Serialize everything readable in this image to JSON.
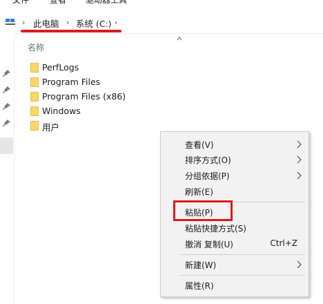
{
  "top_strip": {
    "items": [
      "文件",
      "查看",
      "驱动器工具"
    ]
  },
  "address_bar": {
    "crumbs": [
      "此电脑",
      "系统 (C:)"
    ]
  },
  "file_list": {
    "column_header": "名称",
    "items": [
      {
        "name": "PerfLogs",
        "icon": "folder-icon"
      },
      {
        "name": "Program Files",
        "icon": "folder-icon"
      },
      {
        "name": "Program Files (x86)",
        "icon": "folder-icon"
      },
      {
        "name": "Windows",
        "icon": "folder-icon"
      },
      {
        "name": "用户",
        "icon": "folder-icon"
      }
    ]
  },
  "context_menu": {
    "view": "查看(V)",
    "sort_by": "排序方式(O)",
    "group_by": "分组依据(P)",
    "refresh": "刷新(E)",
    "paste": "粘贴(P)",
    "paste_shortcut": "粘贴快捷方式(S)",
    "undo_copy": "撤消 复制(U)",
    "undo_copy_shortcut": "Ctrl+Z",
    "new": "新建(W)",
    "properties": "属性(R)"
  },
  "colors": {
    "annotation_red": "#e3151a",
    "folder_yellow": "#ffd563"
  }
}
